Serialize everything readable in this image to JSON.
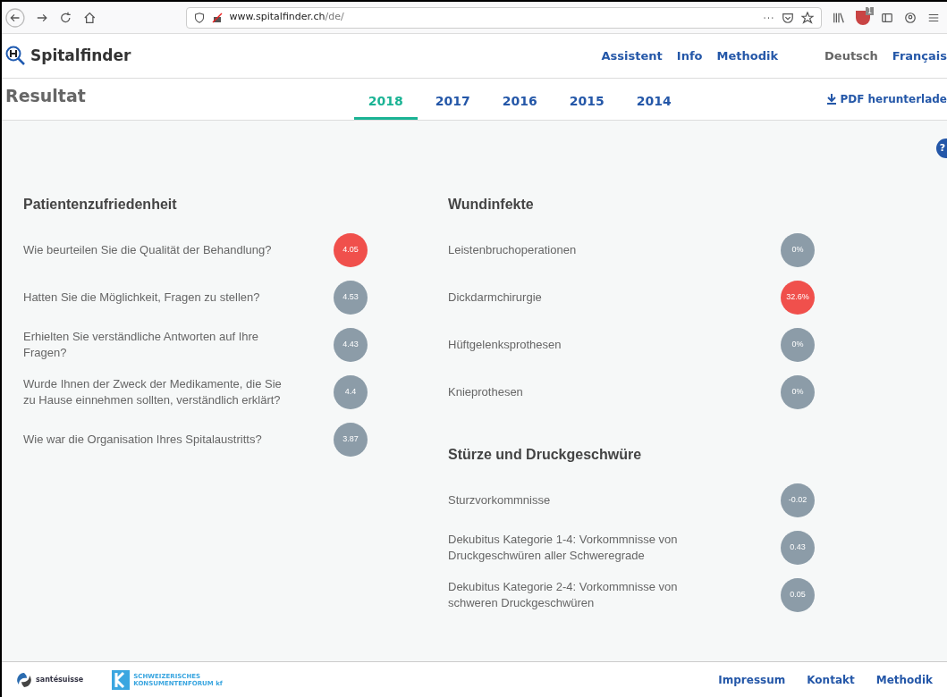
{
  "browser": {
    "url_host": "www.spitalfinder.ch",
    "url_path": "/de/",
    "extension_badge": "1"
  },
  "header": {
    "logo_text": "Spitalfinder",
    "nav": [
      "Assistent",
      "Info",
      "Methodik"
    ],
    "languages": [
      {
        "label": "Deutsch",
        "selected": true
      },
      {
        "label": "Français",
        "selected": false
      }
    ]
  },
  "title": "Resultat",
  "years": [
    {
      "label": "2018",
      "selected": true
    },
    {
      "label": "2017",
      "selected": false
    },
    {
      "label": "2016",
      "selected": false
    },
    {
      "label": "2015",
      "selected": false
    },
    {
      "label": "2014",
      "selected": false
    }
  ],
  "pdf_link": "PDF herunterlade",
  "help": "?",
  "columns": [
    {
      "sections": [
        {
          "title": "Patientenzufriedenheit",
          "items": [
            {
              "label": "Wie beurteilen Sie die Qualität der Behandlung?",
              "value": "4.05",
              "color": "#f0504c"
            },
            {
              "label": "Hatten Sie die Möglichkeit, Fragen zu stellen?",
              "value": "4.53",
              "color": "#8c9ca8"
            },
            {
              "label": "Erhielten Sie verständliche Antworten auf Ihre Fragen?",
              "value": "4.43",
              "color": "#8c9ca8"
            },
            {
              "label": "Wurde Ihnen der Zweck der Medikamente, die Sie zu Hause einnehmen sollten, verständlich erklärt?",
              "value": "4.4",
              "color": "#8c9ca8"
            },
            {
              "label": "Wie war die Organisation Ihres Spitalaustritts?",
              "value": "3.87",
              "color": "#8c9ca8"
            }
          ]
        }
      ]
    },
    {
      "sections": [
        {
          "title": "Wundinfekte",
          "items": [
            {
              "label": "Leistenbruchoperationen",
              "value": "0%",
              "color": "#8c9ca8"
            },
            {
              "label": "Dickdarmchirurgie",
              "value": "32.6%",
              "color": "#f0504c"
            },
            {
              "label": "Hüftgelenksprothesen",
              "value": "0%",
              "color": "#8c9ca8"
            },
            {
              "label": "Knieprothesen",
              "value": "0%",
              "color": "#8c9ca8"
            }
          ]
        },
        {
          "title": "Stürze und Druckgeschwüre",
          "items": [
            {
              "label": "Sturzvorkommnisse",
              "value": "-0.02",
              "color": "#8c9ca8"
            },
            {
              "label": "Dekubitus Kategorie 1-4: Vorkommnisse von Druckgeschwüren aller Schweregrade",
              "value": "0.43",
              "color": "#8c9ca8"
            },
            {
              "label": "Dekubitus Kategorie 2-4: Vorkommnisse von schweren Druckgeschwüren",
              "value": "0.05",
              "color": "#8c9ca8"
            }
          ]
        }
      ]
    }
  ],
  "footer": {
    "partners": [
      {
        "kind": "swirl",
        "name": "santésuisse"
      },
      {
        "kind": "kf",
        "name": "SCHWEIZERISCHES KONSUMENTENFORUM kf"
      }
    ],
    "links": [
      "Impressum",
      "Kontakt",
      "Methodik"
    ]
  }
}
